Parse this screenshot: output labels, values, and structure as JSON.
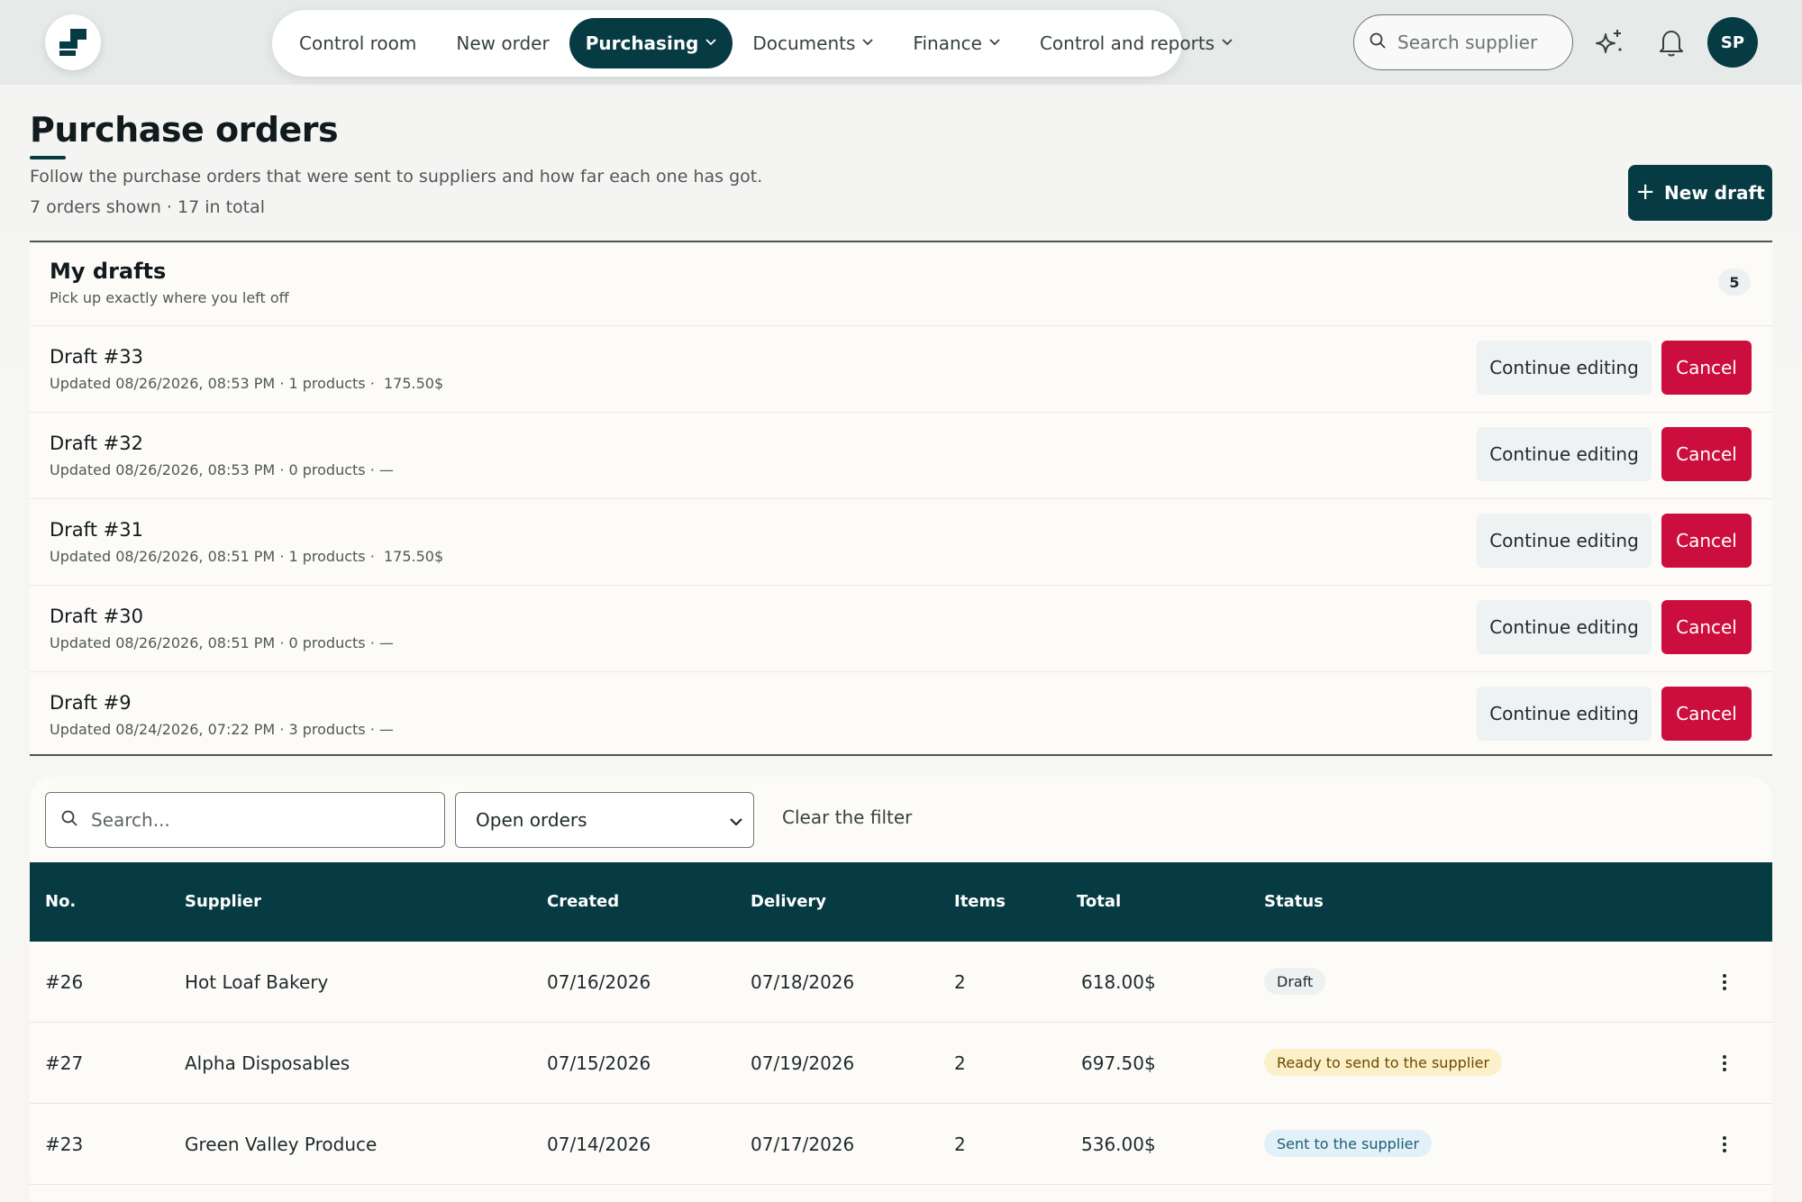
{
  "nav": {
    "items": [
      {
        "label": "Control room",
        "dropdown": false,
        "active": false
      },
      {
        "label": "New order",
        "dropdown": false,
        "active": false
      },
      {
        "label": "Purchasing",
        "dropdown": true,
        "active": true
      },
      {
        "label": "Documents",
        "dropdown": true,
        "active": false
      },
      {
        "label": "Finance",
        "dropdown": true,
        "active": false
      },
      {
        "label": "Control and reports",
        "dropdown": true,
        "active": false
      }
    ],
    "search_placeholder": "Search supplier",
    "avatar_initials": "SP"
  },
  "header": {
    "title": "Purchase orders",
    "subtitle": "Follow the purchase orders that were sent to suppliers and how far each one has got.",
    "counts": "7 orders shown · 17 in total",
    "new_draft_label": "New draft"
  },
  "drafts": {
    "title": "My drafts",
    "subtitle": "Pick up exactly where you left off",
    "count": "5",
    "continue_label": "Continue editing",
    "cancel_label": "Cancel",
    "items": [
      {
        "name": "Draft #33",
        "meta": "Updated 08/26/2026, 08:53 PM · 1 products ·  175.50$"
      },
      {
        "name": "Draft #32",
        "meta": "Updated 08/26/2026, 08:53 PM · 0 products · —"
      },
      {
        "name": "Draft #31",
        "meta": "Updated 08/26/2026, 08:51 PM · 1 products ·  175.50$"
      },
      {
        "name": "Draft #30",
        "meta": "Updated 08/26/2026, 08:51 PM · 0 products · —"
      },
      {
        "name": "Draft #9",
        "meta": "Updated 08/24/2026, 07:22 PM · 3 products · —"
      }
    ]
  },
  "filters": {
    "search_placeholder": "Search...",
    "status_selected": "Open orders",
    "clear_label": "Clear the filter"
  },
  "table": {
    "columns": [
      "No.",
      "Supplier",
      "Created",
      "Delivery",
      "Items",
      "Total",
      "Status"
    ],
    "rows": [
      {
        "no": "#26",
        "supplier": "Hot Loaf Bakery",
        "created": "07/16/2026",
        "delivery": "07/18/2026",
        "items": "2",
        "total": "618.00$",
        "status": "Draft",
        "status_kind": "draft"
      },
      {
        "no": "#27",
        "supplier": "Alpha Disposables",
        "created": "07/15/2026",
        "delivery": "07/19/2026",
        "items": "2",
        "total": "697.50$",
        "status": "Ready to send to the supplier",
        "status_kind": "ready"
      },
      {
        "no": "#23",
        "supplier": "Green Valley Produce",
        "created": "07/14/2026",
        "delivery": "07/17/2026",
        "items": "2",
        "total": "536.00$",
        "status": "Sent to the supplier",
        "status_kind": "sent"
      }
    ]
  },
  "colors": {
    "brand": "#073b44",
    "danger": "#cc0e3e",
    "ready_bg": "#fbf0c8",
    "sent_bg": "#e1f1f7"
  },
  "icons": [
    "logo-icon",
    "search-icon",
    "sparkle-icon",
    "bell-icon",
    "plus-icon",
    "chevron-down-icon",
    "kebab-icon"
  ]
}
